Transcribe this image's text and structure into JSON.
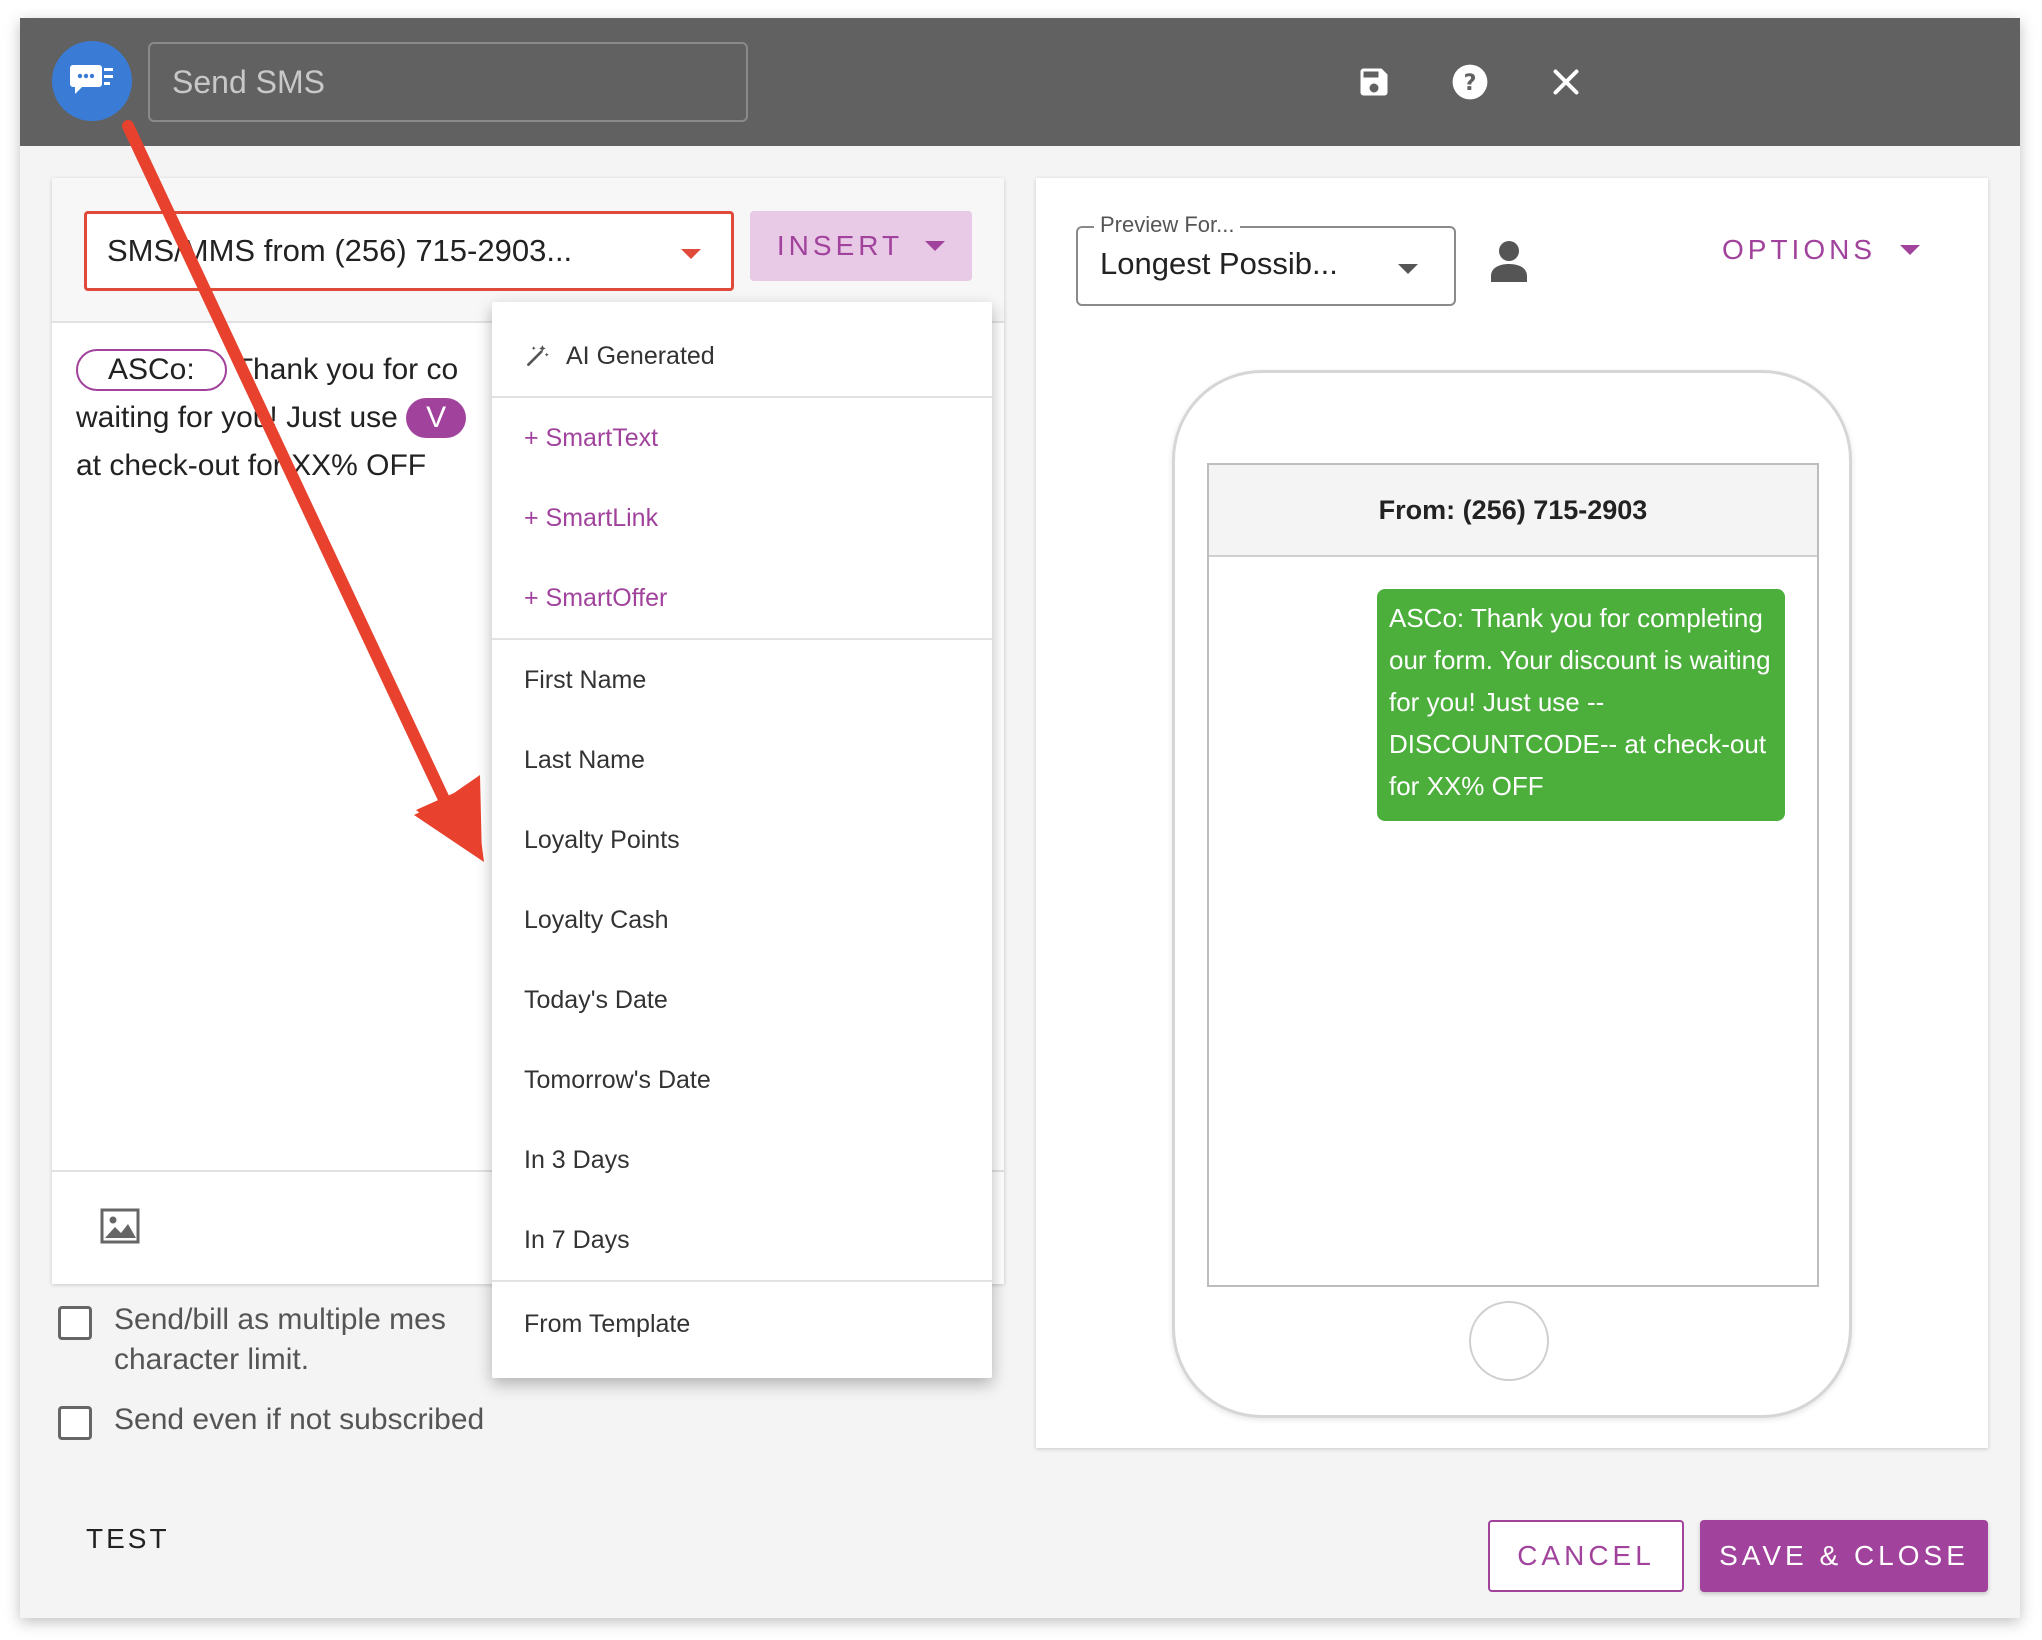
{
  "header": {
    "title_placeholder": "Send SMS",
    "icons": {
      "app": "sms-chat-icon",
      "save": "save-icon",
      "help": "help-icon",
      "close": "close-icon"
    }
  },
  "editor": {
    "sender_select_value": "SMS/MMS from (256) 715-2903...",
    "insert_label": "INSERT",
    "message": {
      "chip_outline": "ASCo:",
      "line1_text": "Thank you for co",
      "line2_text": "waiting for you! Just use",
      "chip_filled": "V",
      "line3_text": "at check-out for XX% OFF"
    },
    "image_icon": "image-icon"
  },
  "insert_menu": {
    "ai_generated": "AI Generated",
    "smart_items": [
      "+ SmartText",
      "+ SmartLink",
      "+ SmartOffer"
    ],
    "field_items": [
      "First Name",
      "Last Name",
      "Loyalty Points",
      "Loyalty Cash",
      "Today's Date",
      "Tomorrow's Date",
      "In 3 Days",
      "In 7 Days"
    ],
    "template_item": "From Template"
  },
  "checkboxes": {
    "multi_line1": "Send/bill as multiple mes",
    "multi_line2": "character limit.",
    "not_subscribed": "Send even if not subscribed"
  },
  "test_label": "TEST",
  "preview": {
    "preview_for_label": "Preview For...",
    "preview_for_value": "Longest Possib...",
    "options_label": "OPTIONS",
    "from_label": "From: (256) 715-2903",
    "bubble_text": "ASCo: Thank you for completing our form. Your discount is waiting for you! Just use --DISCOUNTCODE-- at check-out for XX% OFF"
  },
  "footer": {
    "cancel_label": "CANCEL",
    "save_close_label": "SAVE & CLOSE"
  },
  "colors": {
    "header_bg": "#616161",
    "accent": "#a1439c",
    "bubble_green": "#4caf3c",
    "annotation_red": "#e8412d",
    "app_icon_blue": "#3a7bd5"
  }
}
